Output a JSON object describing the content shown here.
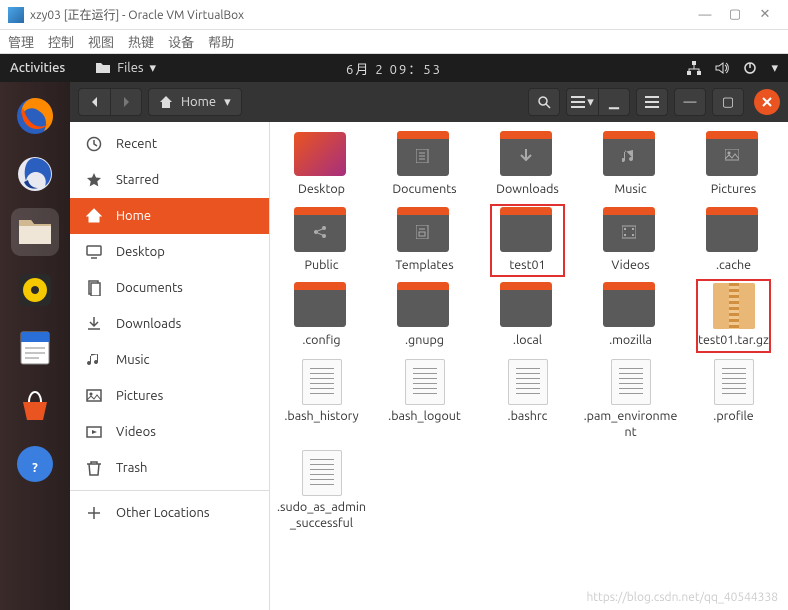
{
  "vbox": {
    "title": "xzy03 [正在运行] - Oracle VM VirtualBox",
    "menu": [
      "管理",
      "控制",
      "视图",
      "热键",
      "设备",
      "帮助"
    ]
  },
  "gnome": {
    "activities": "Activities",
    "app_label": "Files",
    "datetime": "6月 2  09：53"
  },
  "path": {
    "location": "Home"
  },
  "sidebar": {
    "items": [
      {
        "label": "Recent",
        "icon": "clock"
      },
      {
        "label": "Starred",
        "icon": "star"
      },
      {
        "label": "Home",
        "icon": "home",
        "active": true
      },
      {
        "label": "Desktop",
        "icon": "desktop"
      },
      {
        "label": "Documents",
        "icon": "documents"
      },
      {
        "label": "Downloads",
        "icon": "downloads"
      },
      {
        "label": "Music",
        "icon": "music"
      },
      {
        "label": "Pictures",
        "icon": "pictures"
      },
      {
        "label": "Videos",
        "icon": "videos"
      },
      {
        "label": "Trash",
        "icon": "trash"
      }
    ],
    "other": "Other Locations"
  },
  "files": [
    {
      "label": "Desktop",
      "type": "desktop"
    },
    {
      "label": "Documents",
      "type": "folder",
      "glyph": "doc"
    },
    {
      "label": "Downloads",
      "type": "folder",
      "glyph": "down"
    },
    {
      "label": "Music",
      "type": "folder",
      "glyph": "music"
    },
    {
      "label": "Pictures",
      "type": "folder",
      "glyph": "pic"
    },
    {
      "label": "Public",
      "type": "folder",
      "glyph": "share"
    },
    {
      "label": "Templates",
      "type": "folder",
      "glyph": "tmpl"
    },
    {
      "label": "test01",
      "type": "folder",
      "highlight": true
    },
    {
      "label": "Videos",
      "type": "folder",
      "glyph": "video"
    },
    {
      "label": ".cache",
      "type": "folder"
    },
    {
      "label": ".config",
      "type": "folder"
    },
    {
      "label": ".gnupg",
      "type": "folder"
    },
    {
      "label": ".local",
      "type": "folder"
    },
    {
      "label": ".mozilla",
      "type": "folder"
    },
    {
      "label": "test01.tar.gz",
      "type": "archive",
      "highlight": true
    },
    {
      "label": ".bash_history",
      "type": "text"
    },
    {
      "label": ".bash_logout",
      "type": "text"
    },
    {
      "label": ".bashrc",
      "type": "text"
    },
    {
      "label": ".pam_environment",
      "type": "text"
    },
    {
      "label": ".profile",
      "type": "text"
    },
    {
      "label": ".sudo_as_admin_successful",
      "type": "text"
    }
  ],
  "watermark": "https://blog.csdn.net/qq_40544338"
}
